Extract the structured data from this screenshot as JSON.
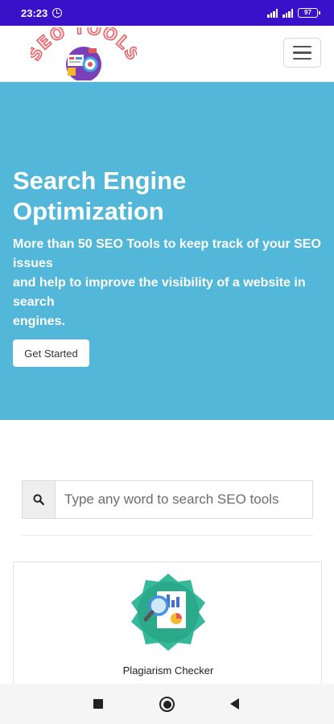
{
  "status_bar": {
    "time": "23:23",
    "battery": "97",
    "icons": [
      "alarm-icon",
      "signal-icon",
      "signal-icon",
      "battery-icon"
    ]
  },
  "header": {
    "logo_text": "SEO TOOLS",
    "menu_icon": "hamburger-menu-icon"
  },
  "hero": {
    "title_line1": "Search Engine",
    "title_line2": "Optimization",
    "subtitle_lines": [
      "More than 50 SEO Tools to keep track of your SEO",
      "issues",
      "and help to improve the visibility of a website in",
      "search",
      "engines."
    ],
    "cta_label": "Get Started",
    "background": "#52b7d8"
  },
  "search": {
    "placeholder": "Type any word to search SEO tools",
    "icon": "search-icon"
  },
  "tools": [
    {
      "label": "Plagiarism Checker",
      "icon": "plagiarism-checker-icon"
    }
  ],
  "nav": {
    "icons": [
      "recent-apps-icon",
      "home-icon",
      "back-icon"
    ]
  },
  "colors": {
    "status_bar": "#3a10c9",
    "hero": "#52b7d8",
    "tool_icon_bg": "#36b89a",
    "logo_text": "#e0575c"
  }
}
